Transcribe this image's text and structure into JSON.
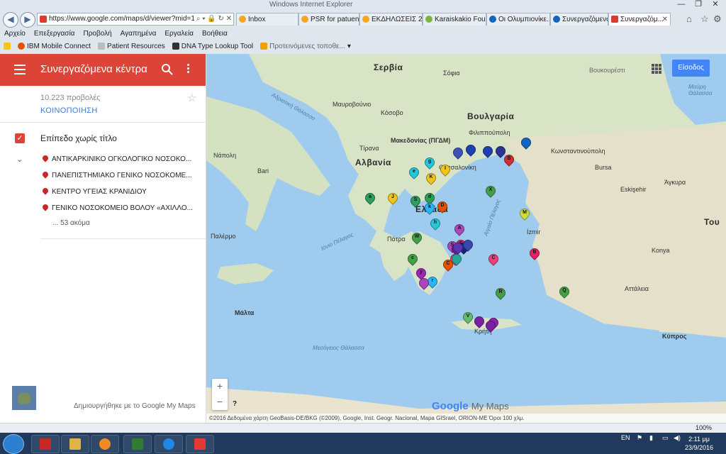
{
  "browser": {
    "window_title": "Windows Internet Explorer",
    "url": "https://www.google.com/maps/d/viewer?mid=1-66rZy",
    "tabs": [
      {
        "label": "Inbox",
        "color": "#f5a623"
      },
      {
        "label": "PSR for patuent ...",
        "color": "#f5a623"
      },
      {
        "label": "ΕΚΔΗΛΩΣΕΙΣ 2016",
        "color": "#f5a623"
      },
      {
        "label": "Karaiskakio Fou...",
        "color": "#7cb342"
      },
      {
        "label": "Οι Ολυμπιονίκε...",
        "color": "#1565c0"
      },
      {
        "label": "Συνεργαζόμενα ...",
        "color": "#1565c0"
      },
      {
        "label": "Συνεργαζόμ...",
        "color": "#d93b2f",
        "active": true
      }
    ],
    "menu": [
      "Αρχείο",
      "Επεξεργασία",
      "Προβολή",
      "Αγαπημένα",
      "Εργαλεία",
      "Βοήθεια"
    ],
    "favorites": [
      "IBM Mobile Connect",
      "Patient Resources",
      "DNA Type Lookup Tool",
      "Προτεινόμενες τοποθε..."
    ],
    "zoom": "100%"
  },
  "sidebar": {
    "title": "Συνεργαζόμενα κέντρα",
    "views": "10.223 προβολές",
    "share": "ΚΟΙΝΟΠΟΙΗΣΗ",
    "layer": "Επίπεδο χωρίς τίτλο",
    "items": [
      "ΑΝΤΙΚΑΡΚΙΝΙΚΟ ΟΓΚΟΛΟΓΙΚΟ ΝΟΣΟΚΟ...",
      "ΠΑΝΕΠΙΣΤΗΜΙΑΚΟ ΓΕΝΙΚΟ ΝΟΣΟΚΟΜΕ...",
      "ΚΕΝΤΡΟ ΥΓΕΙΑΣ ΚΡΑΝΙΔΙΟΥ",
      "ΓΕΝΙΚΟ ΝΟΣΟΚΟΜΕΙΟ ΒΟΛΟΥ «ΑΧΙΛΛΟ..."
    ],
    "more": "... 53 ακόμα",
    "created_with": "Δημιουργήθηκε με το Google My Maps"
  },
  "map": {
    "signin": "Είσοδος",
    "logo": "Google",
    "logo_suffix": "My Maps",
    "attribution": "©2016 Δεδομένα χάρτη GeoBasis-DE/BKG (©2009), Google, Inst. Geogr. Nacional, Mapa GISrael, ORION-ME   Όροι   100 χλμ.",
    "labels": {
      "serbia": "Σερβία",
      "bulgaria": "Βουλγαρία",
      "albania": "Αλβανία",
      "greece": "Ελλάδα",
      "macedonia": "Μακεδονίας (ΠΓΔΜ)",
      "montenegro": "Μαυροβούνιο",
      "kosovo": "Κόσοβο",
      "turkey": "Του",
      "cyprus": "Κύπρος",
      "malta": "Μάλτα",
      "sofia": "Σόφια",
      "istanbul": "Κωνσταντινούπολη",
      "izmir": "İzmir",
      "ankara": "Άγκυρα",
      "bursa": "Bursa",
      "eskisehir": "Eskişehir",
      "konya": "Konya",
      "antalya": "Αττάλεια",
      "tirana": "Τίρανα",
      "naples": "Νάπολη",
      "palermo": "Παλέρμο",
      "bari": "Bari",
      "thessaloniki": "Θεσσαλονίκη",
      "filippoupoli": "Φιλιππούπολη",
      "crete": "Κρήτη",
      "patra": "Πάτρα",
      "ionian": "Ιόνιο Πέλαγος",
      "aegean": "Αιγαίο Πέλαγος",
      "mediterranean": "Μεσόγειος Θάλασσα",
      "adriatic": "Αδριατική Θάλασσα",
      "black_sea": "Μαύρη Θάλασσα",
      "bucharest": "Βουκουρέστι"
    },
    "markers": [
      {
        "l": "a",
        "c": "#2e9e5b"
      },
      {
        "l": "J",
        "c": "#f0c419"
      },
      {
        "l": "S",
        "c": "#2e9e5b"
      },
      {
        "l": "d",
        "c": "#2e9e5b"
      },
      {
        "l": "k",
        "c": "#29b6f6"
      },
      {
        "l": "D",
        "c": "#e65100"
      },
      {
        "l": "e",
        "c": "#26c6da"
      },
      {
        "l": "g",
        "c": "#26c6da"
      },
      {
        "l": "K",
        "c": "#f0c419"
      },
      {
        "l": "I",
        "c": "#f0c419"
      },
      {
        "l": "h",
        "c": "#26c6da"
      },
      {
        "l": "W",
        "c": "#43a047"
      },
      {
        "l": "c",
        "c": "#43a047"
      },
      {
        "l": "A",
        "c": "#ab47bc"
      },
      {
        "l": "S",
        "c": "#ab47bc"
      },
      {
        "l": "F",
        "c": "#e91e63"
      },
      {
        "l": "E",
        "c": "#ec407a"
      },
      {
        "l": "C",
        "c": "#e65100"
      },
      {
        "l": "",
        "c": "#1a237e"
      },
      {
        "l": "",
        "c": "#3949ab"
      },
      {
        "l": "",
        "c": "#6a1b9a"
      },
      {
        "l": "y",
        "c": "#9c27b0"
      },
      {
        "l": "r",
        "c": "#29b6f6"
      },
      {
        "l": "",
        "c": "#26a69a"
      },
      {
        "l": "X",
        "c": "#43a047"
      },
      {
        "l": "M",
        "c": "#cddc39"
      },
      {
        "l": "C",
        "c": "#ec407a"
      },
      {
        "l": "B",
        "c": "#e91e63"
      },
      {
        "l": "R",
        "c": "#43a047"
      },
      {
        "l": "Q",
        "c": "#43a047"
      },
      {
        "l": "V",
        "c": "#66bb6a"
      },
      {
        "l": "",
        "c": "#7b1fa2"
      },
      {
        "l": "",
        "c": "#8e24aa"
      },
      {
        "l": "",
        "c": "#7b1fa2"
      },
      {
        "l": "",
        "c": "#3f51b5"
      },
      {
        "l": "",
        "c": "#1e40af"
      },
      {
        "l": "",
        "c": "#1e40af"
      },
      {
        "l": "",
        "c": "#283593"
      },
      {
        "l": "",
        "c": "#1565c0"
      },
      {
        "l": "B",
        "c": "#d32f2f"
      },
      {
        "l": "",
        "c": "#5e35b1"
      },
      {
        "l": "",
        "c": "#ab47bc"
      }
    ]
  },
  "taskbar": {
    "lang": "EN",
    "time": "2:11 μμ",
    "date": "23/9/2016"
  }
}
